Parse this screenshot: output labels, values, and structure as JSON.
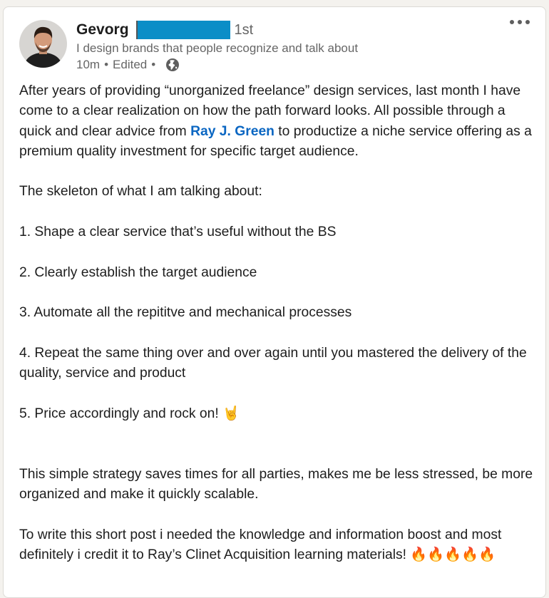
{
  "author": {
    "name": "Gevorg",
    "degree": "1st",
    "headline": "I design brands that people recognize and talk about",
    "time": "10m",
    "edited": "Edited"
  },
  "post": {
    "p1_before": "After years of providing “unorganized freelance” design services, last month I have come to a clear realization on how the path forward looks. All possible through a quick and clear advice from ",
    "mention": "Ray J. Green",
    "p1_after": " to productize a niche service offering as a premium quality investment for specific target audience.",
    "p2": "The skeleton of what I am talking about:",
    "list": [
      "1. Shape a clear service that’s useful without the BS",
      "2. Clearly establish the target audience",
      "3. Automate all the repititve and mechanical processes",
      "4. Repeat the same thing over and over again until you mastered the delivery of the quality, service and product",
      "5. Price accordingly and rock on! 🤘"
    ],
    "p3": "This simple strategy saves times for all parties, makes me be less stressed, be more organized and make it quickly scalable.",
    "p4": "To write this short post i needed the knowledge and information boost and most definitely i credit it to Ray’s Clinet Acquisition learning materials! 🔥🔥🔥🔥🔥"
  },
  "icons": {
    "avatar": "avatar-photo",
    "visibility": "globe-icon",
    "menu": "more-options-icon"
  },
  "colors": {
    "mention": "#0a66c2",
    "redaction": "#0b8ec7",
    "text": "#1d1d1d",
    "muted": "#666666"
  }
}
